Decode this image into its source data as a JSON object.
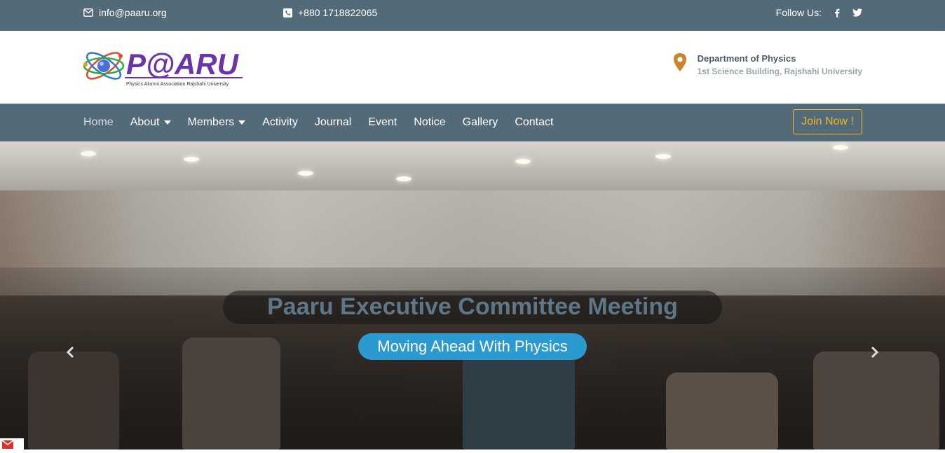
{
  "topbar": {
    "email": "info@paaru.org",
    "phone": "+880 1718822065",
    "follow_label": "Follow Us:"
  },
  "header": {
    "logo_text": "P@ARU",
    "logo_subtitle": "Physics Alumni Association Rajshahi University",
    "address_line1": "Department of Physics",
    "address_line2": "1st Science Building, Rajshahi University"
  },
  "nav": {
    "items": [
      {
        "label": "Home"
      },
      {
        "label": "About"
      },
      {
        "label": "Members"
      },
      {
        "label": "Activity"
      },
      {
        "label": "Journal"
      },
      {
        "label": "Event"
      },
      {
        "label": "Notice"
      },
      {
        "label": "Gallery"
      },
      {
        "label": "Contact"
      }
    ],
    "join_label": "Join Now !"
  },
  "hero": {
    "title": "Paaru Executive Committee Meeting",
    "subtitle": "Moving Ahead With Physics"
  },
  "colors": {
    "bar": "#536b78",
    "accent": "#f0b42a",
    "pill": "#2a9ad0"
  }
}
